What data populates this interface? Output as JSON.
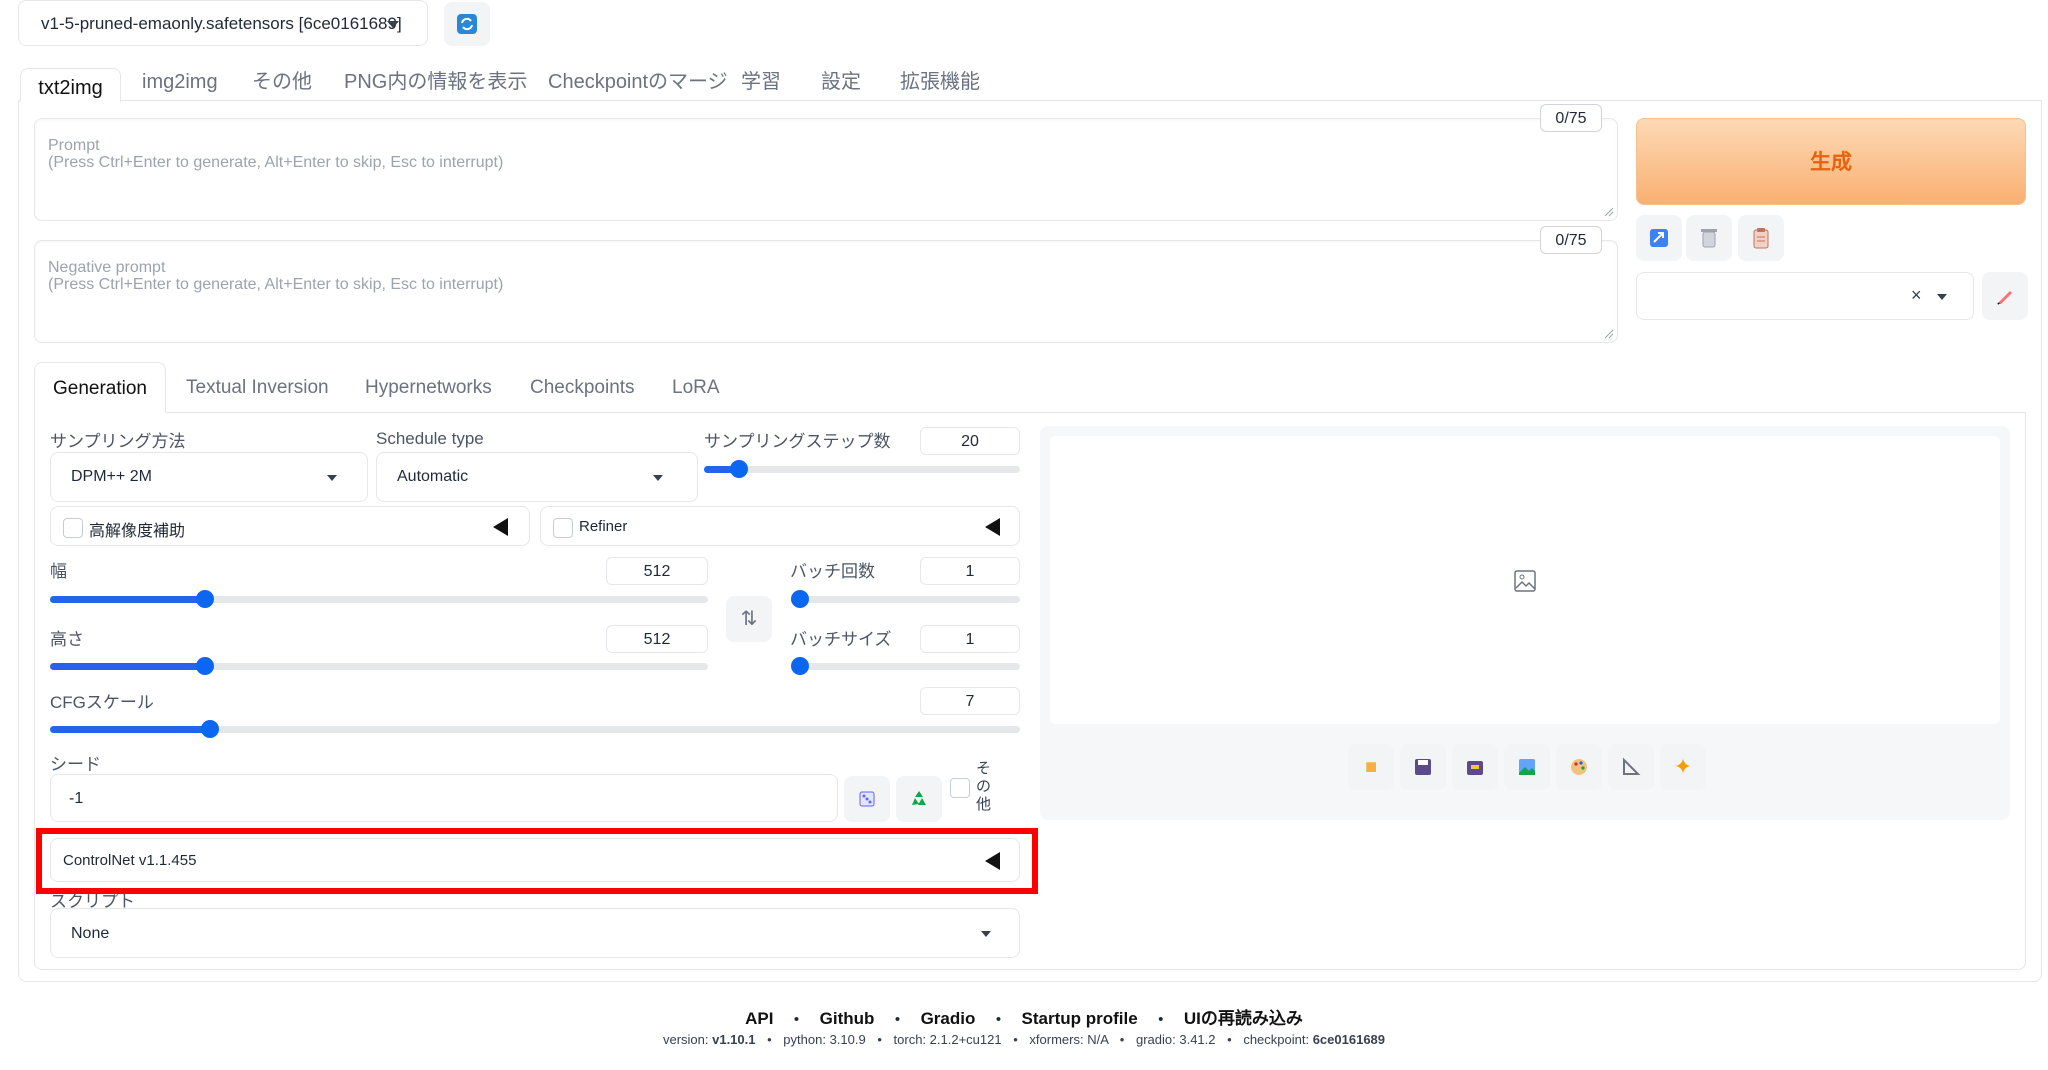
{
  "checkpoint": {
    "selected": "v1-5-pruned-emaonly.safetensors [6ce0161689]"
  },
  "tabs": [
    "txt2img",
    "img2img",
    "その他",
    "PNG内の情報を表示",
    "Checkpointのマージ",
    "学習",
    "設定",
    "拡張機能"
  ],
  "prompt": {
    "counter": "0/75",
    "label": "Prompt",
    "hint": "(Press Ctrl+Enter to generate, Alt+Enter to skip, Esc to interrupt)"
  },
  "negative": {
    "counter": "0/75",
    "label": "Negative prompt",
    "hint": "(Press Ctrl+Enter to generate, Alt+Enter to skip, Esc to interrupt)"
  },
  "generate_label": "生成",
  "subtabs": [
    "Generation",
    "Textual Inversion",
    "Hypernetworks",
    "Checkpoints",
    "LoRA"
  ],
  "sampling": {
    "method_label": "サンプリング方法",
    "method": "DPM++ 2M",
    "schedule_label": "Schedule type",
    "schedule": "Automatic",
    "steps_label": "サンプリングステップ数",
    "steps": "20"
  },
  "hires": {
    "label": "高解像度補助"
  },
  "refiner": {
    "label": "Refiner"
  },
  "width": {
    "label": "幅",
    "value": "512"
  },
  "height": {
    "label": "高さ",
    "value": "512"
  },
  "batch_count": {
    "label": "バッチ回数",
    "value": "1"
  },
  "batch_size": {
    "label": "バッチサイズ",
    "value": "1"
  },
  "cfg": {
    "label": "CFGスケール",
    "value": "7"
  },
  "seed": {
    "label": "シード",
    "value": "-1",
    "extra_label": "その他"
  },
  "controlnet": {
    "label": "ControlNet v1.1.455"
  },
  "script": {
    "label": "スクリプト",
    "value": "None"
  },
  "footer": {
    "links": [
      "API",
      "Github",
      "Gradio",
      "Startup profile",
      "UIの再読み込み"
    ],
    "separator": "•",
    "versions": [
      {
        "k": "version: ",
        "v": "v1.10.1"
      },
      {
        "k": "python: ",
        "v": "3.10.9"
      },
      {
        "k": "torch: ",
        "v": "2.1.2+cu121"
      },
      {
        "k": "xformers: ",
        "v": "N/A"
      },
      {
        "k": "gradio: ",
        "v": "3.41.2"
      },
      {
        "k": "checkpoint: ",
        "v": "6ce0161689"
      }
    ]
  },
  "colors": {
    "accent": "#0b67f0",
    "generate_bg": "#fbc290",
    "generate_text": "#e8610c",
    "highlight": "#ff0000"
  }
}
